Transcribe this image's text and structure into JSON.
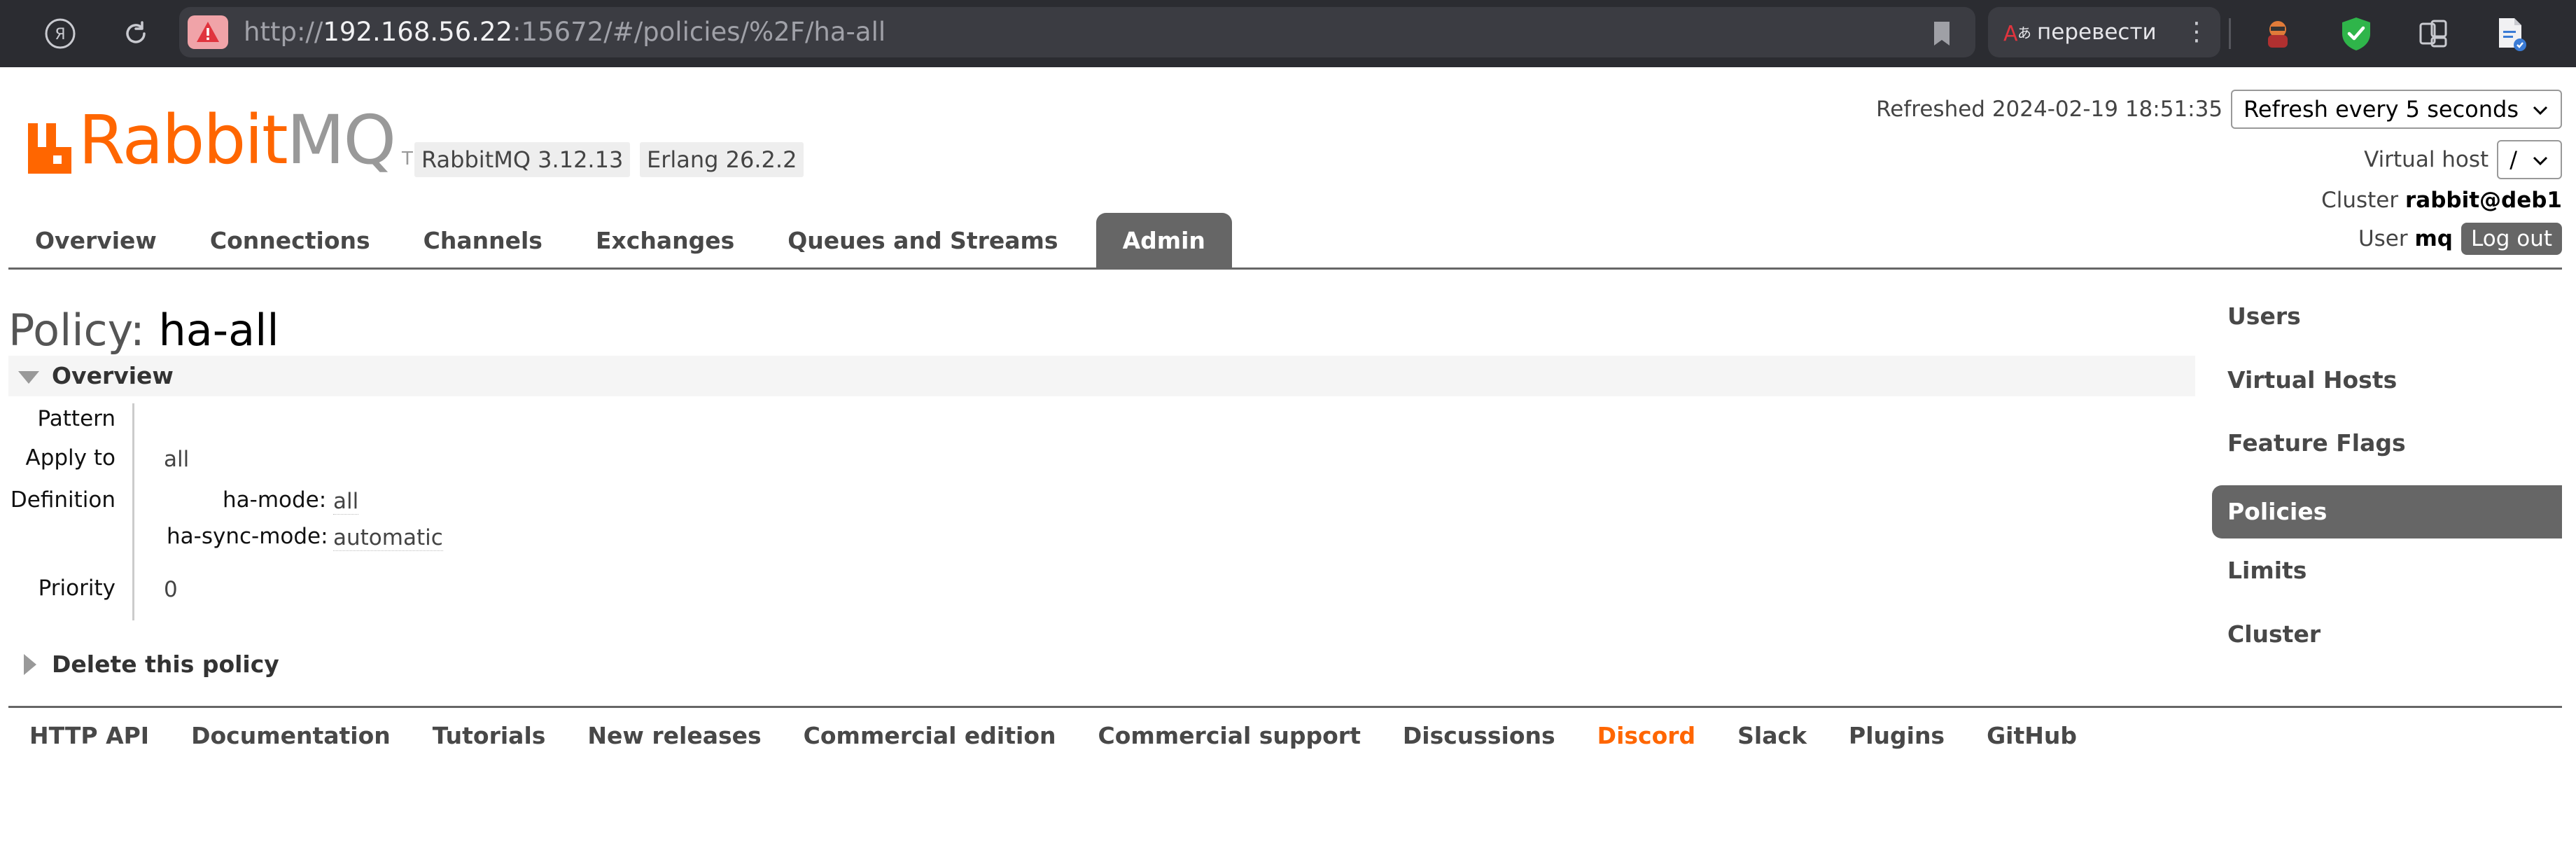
{
  "browser": {
    "url_prefix": "http://",
    "url_host": "192.168.56.22",
    "url_rest": ":15672/#/policies/%2F/ha-all",
    "translate_label": "перевести",
    "kebab": "⋮"
  },
  "logo": {
    "rabbit": "Rabbit",
    "mq": "MQ",
    "tm": "TM"
  },
  "versions": {
    "rabbitmq": "RabbitMQ 3.12.13",
    "erlang": "Erlang 26.2.2"
  },
  "header": {
    "refreshed_text": "Refreshed 2024-02-19 18:51:35",
    "refresh_select": "Refresh every 5 seconds",
    "vhost_label": "Virtual host",
    "vhost_value": "/",
    "cluster_label": "Cluster",
    "cluster_name": "rabbit@deb1",
    "user_label": "User",
    "user_name": "mq",
    "logout_label": "Log out"
  },
  "tabs": [
    {
      "label": "Overview"
    },
    {
      "label": "Connections"
    },
    {
      "label": "Channels"
    },
    {
      "label": "Exchanges"
    },
    {
      "label": "Queues and Streams"
    },
    {
      "label": "Admin",
      "active": true
    }
  ],
  "page": {
    "title_prefix": "Policy:",
    "title_name": "ha-all",
    "overview_label": "Overview",
    "facts": {
      "pattern_label": "Pattern",
      "pattern_value": "",
      "apply_to_label": "Apply to",
      "apply_to_value": "all",
      "definition_label": "Definition",
      "definition": [
        {
          "key": "ha-mode:",
          "value": "all"
        },
        {
          "key": "ha-sync-mode:",
          "value": "automatic"
        }
      ],
      "priority_label": "Priority",
      "priority_value": "0"
    },
    "delete_label": "Delete this policy"
  },
  "sidebar": {
    "items": [
      {
        "label": "Users"
      },
      {
        "label": "Virtual Hosts"
      },
      {
        "label": "Feature Flags"
      },
      {
        "label": "Policies",
        "active": true
      },
      {
        "label": "Limits"
      },
      {
        "label": "Cluster"
      }
    ]
  },
  "footer": {
    "links": [
      {
        "label": "HTTP API"
      },
      {
        "label": "Documentation"
      },
      {
        "label": "Tutorials"
      },
      {
        "label": "New releases"
      },
      {
        "label": "Commercial edition"
      },
      {
        "label": "Commercial support"
      },
      {
        "label": "Discussions"
      },
      {
        "label": "Discord",
        "color": "#ff6600"
      },
      {
        "label": "Slack"
      },
      {
        "label": "Plugins"
      },
      {
        "label": "GitHub"
      }
    ]
  },
  "colors": {
    "brand_orange": "#ff6600",
    "tab_active_bg": "#666666",
    "browser_bar": "#2b2c31"
  }
}
